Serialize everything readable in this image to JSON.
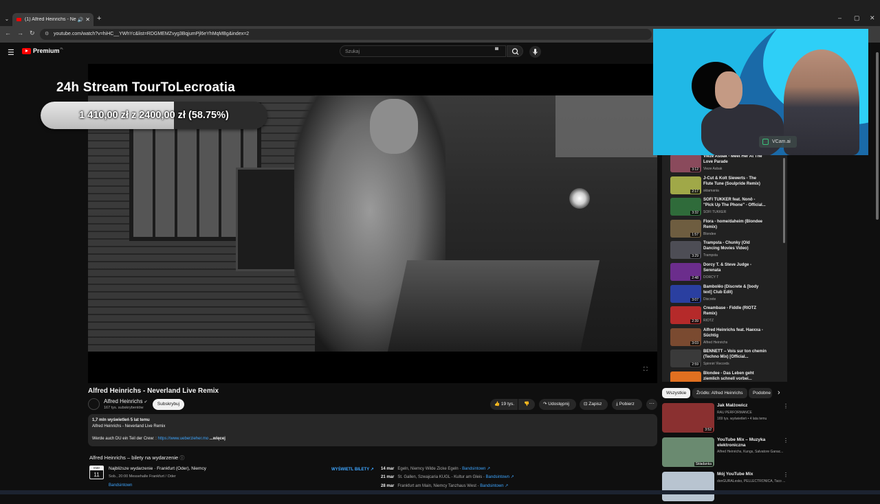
{
  "browser": {
    "tab_title": "(1) Alfred Heinrichs - Never",
    "sound_icon": "🔊",
    "close_icon": "✕",
    "new_tab": "+",
    "url": "youtube.com/watch?v=hiHC__YWhYc&list=RDGMEMZvyg3BqjumPjl6eYhMqMBg&index=2",
    "min": "–",
    "max": "▢",
    "close": "✕"
  },
  "youtube": {
    "logo_word": "Premium",
    "logo_region": "PL",
    "search_placeholder": "Szukaj"
  },
  "video": {
    "overlay_title": "24h Stream TourToLecroatia",
    "goal_text": "1 410,00 zł z 2400,00 zł (58.75%)",
    "goal_fraction": 0.5875,
    "title": "Alfred Heinrichs - Neverland Live Remix"
  },
  "channel": {
    "name": "Alfred Heinrichs",
    "subs": "167 tys. subskrybentów",
    "subscribe": "Subskrybuj"
  },
  "actions": {
    "likes": "19 tys.",
    "share": "Udostępnij",
    "save": "Zapisz",
    "download": "Pobierz",
    "more": "···"
  },
  "description": {
    "stats": "1,7 mln wyświetleń  5 lat temu",
    "line1": "Alfred Heinrichs - Neverland Live Remix",
    "line2_text": "Werde auch DU ein Teil der Crew: : ",
    "line2_link": "https://www.ueberzieher.mo",
    "more": " ...więcej"
  },
  "tickets": {
    "heading": "Alfred Heinrichs – bilety na wydarzenie",
    "month": "KWI",
    "day": "11",
    "next_title": "Najbliższe wydarzenie · Frankfurt (Oder), Niemcy",
    "next_sub": "Sob., 20:00 Messehalle Frankfurt / Oder",
    "next_link": "Bandsintown",
    "show_tickets": "WYŚWIETL BILETY ↗",
    "events": [
      {
        "date": "14 mar",
        "place": "Egeln, Niemcy Wilde Zicke Egeln",
        "link": "Bandsintown ↗"
      },
      {
        "date": "21 mar",
        "place": "St. Gallen, Szwajcaria KUGL - Kultur am Gleis",
        "link": "Bandsintown ↗"
      },
      {
        "date": "28 mar",
        "place": "Frankfurt am Main, Niemcy Tanzhaus West",
        "link": "Bandsintown ↗"
      }
    ]
  },
  "webcam": {
    "badge": "VCam.ai"
  },
  "playlist": [
    {
      "title": "Vieze Asbak - Meet Her At The Love Parade",
      "channel": "Vieze Asbak",
      "dur": "3:12",
      "color": "#8a4a5c"
    },
    {
      "title": "J-Cut & Kolt Siewerts - The Flute Tune (Soulpride Remix)",
      "channel": "sktamania",
      "dur": "2:17",
      "color": "#a0a848"
    },
    {
      "title": "SOFI TUKKER feat. Nonô - \"Pick Up The Phone\" - Official...",
      "channel": "SOFI TUKKER",
      "dur": "3:32",
      "color": "#2f6b3a"
    },
    {
      "title": "Flora - home/daheim (Blondee Remix)",
      "channel": "Blondee",
      "dur": "1:57",
      "color": "#6e5d40"
    },
    {
      "title": "Trampsta - Chunky (Old Dancing Movies Video)",
      "channel": "Trampsta",
      "dur": "3:29",
      "color": "#4d4d55"
    },
    {
      "title": "Dorcy T. & Steve Judge - Serenata",
      "channel": "DORCY T",
      "dur": "2:48",
      "color": "#6b2d8c"
    },
    {
      "title": "Bambolêo (Discrete & [body text] Club Edit)",
      "channel": "Discrete",
      "dur": "3:07",
      "color": "#2a3fa0"
    },
    {
      "title": "Creambase - Fiddle (RIOTZ Remix)",
      "channel": "RIOTZ",
      "dur": "2:39",
      "color": "#b52a2a"
    },
    {
      "title": "Alfred Heinrichs feat. Haexxa - Süchtig",
      "channel": "Alfred Heinrichs",
      "dur": "3:03",
      "color": "#7a4a30"
    },
    {
      "title": "BENNETT – Vois sur ton chemin (Techno Mix) [Official...",
      "channel": "Spinnin' Records",
      "dur": "2:59",
      "color": "#3a3a3a"
    },
    {
      "title": "Blondee - Das Leben geht ziemlich schnell vorbei...",
      "channel": "",
      "dur": "3:40",
      "color": "#e07020"
    }
  ],
  "chips": {
    "all": "Wszystkie",
    "source": "Źródło: Alfred Heinrichs",
    "similar": "Podobne",
    "next": "›"
  },
  "recommendations": [
    {
      "title": "Jak Małżowicz",
      "line1": "RAU PERFORMANCE",
      "line2": "169 tys. wyświetleń • 4 lata temu",
      "badge": "3:52",
      "color": "#8a3030"
    },
    {
      "title": "YouTube Mix – Muzyka elektroniczna",
      "line1": "Alfred Heinrichs, Kungs, Salvatore Ganac...",
      "line2": "",
      "badge": "Składanka",
      "color": "#6a8a70"
    },
    {
      "title": "Mój YouTube Mix",
      "line1": "donGURALesko, PELLECTRONICA, Taco ...",
      "line2": "",
      "badge": "",
      "color": "#b8c4d0"
    }
  ]
}
